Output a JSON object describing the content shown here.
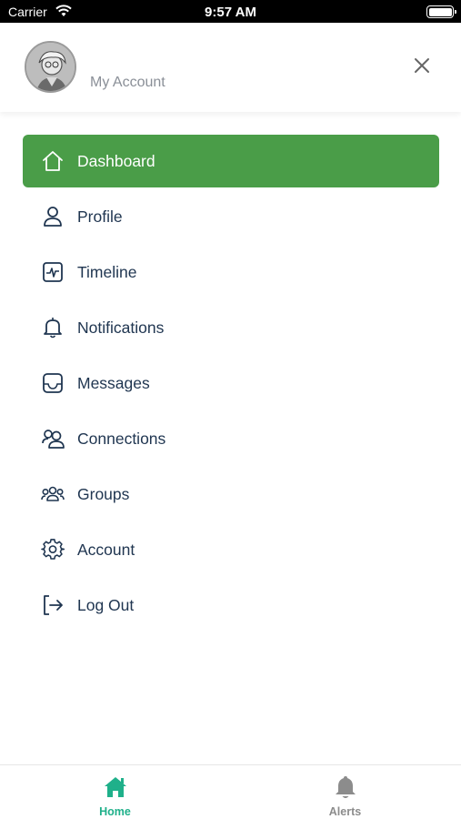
{
  "status_bar": {
    "carrier": "Carrier",
    "time": "9:57 AM"
  },
  "header": {
    "account_label": "My Account"
  },
  "menu": {
    "items": [
      {
        "label": "Dashboard",
        "icon": "home-icon",
        "active": true
      },
      {
        "label": "Profile",
        "icon": "user-icon"
      },
      {
        "label": "Timeline",
        "icon": "activity-icon"
      },
      {
        "label": "Notifications",
        "icon": "bell-icon"
      },
      {
        "label": "Messages",
        "icon": "inbox-icon"
      },
      {
        "label": "Connections",
        "icon": "users-icon"
      },
      {
        "label": "Groups",
        "icon": "group-icon"
      },
      {
        "label": "Account",
        "icon": "gear-icon"
      },
      {
        "label": "Log Out",
        "icon": "logout-icon"
      }
    ]
  },
  "tabbar": {
    "tabs": [
      {
        "label": "Home",
        "icon": "home-filled-icon",
        "active": true
      },
      {
        "label": "Alerts",
        "icon": "bell-filled-icon"
      }
    ]
  },
  "colors": {
    "accent": "#4a9d48",
    "tab_active": "#1fb08a",
    "tab_inactive": "#8c8c8c",
    "text": "#1f3550"
  }
}
